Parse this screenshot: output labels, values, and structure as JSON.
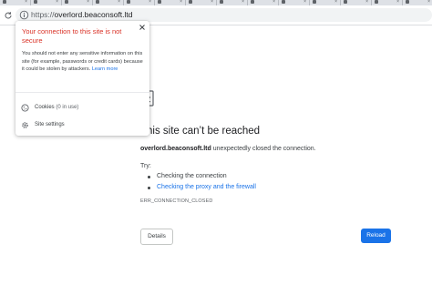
{
  "tabs": [
    {
      "label": "",
      "color": "#5f6368"
    },
    {
      "label": "",
      "color": "#5f6368"
    },
    {
      "label": "",
      "color": "#5f6368"
    },
    {
      "label": "",
      "color": "#5f6368"
    },
    {
      "label": "",
      "color": "#5f6368"
    },
    {
      "label": "",
      "color": "#5f6368"
    },
    {
      "label": "",
      "color": "#5f6368"
    },
    {
      "label": "",
      "color": "#5f6368"
    },
    {
      "label": "",
      "color": "#5f6368"
    },
    {
      "label": "",
      "color": "#5f6368"
    },
    {
      "label": "",
      "color": "#5f6368"
    },
    {
      "label": "",
      "color": "#5f6368"
    },
    {
      "label": "",
      "color": "#5f6368"
    },
    {
      "label": "",
      "color": "#5f6368"
    }
  ],
  "toolbar": {
    "url_scheme": "https://",
    "url_host": "overlord.beaconsoft.ltd",
    "reload_icon": "reload-icon",
    "info_icon": "info-icon"
  },
  "popup": {
    "title": "Your connection to this site is not secure",
    "body": "You should not enter any sensitive information on this site (for example, passwords or credit cards) because it could be stolen by attackers.",
    "learn_more": "Learn more",
    "cookies_label": "Cookies",
    "cookies_sub": "(0 in use)",
    "site_settings_label": "Site settings"
  },
  "error": {
    "heading": "This site can’t be reached",
    "host": "overlord.beaconsoft.ltd",
    "description": "unexpectedly closed the connection.",
    "try_label": "Try:",
    "suggestions": [
      {
        "text": "Checking the connection",
        "is_link": false
      },
      {
        "text": "Checking the proxy and the firewall",
        "is_link": true
      }
    ],
    "code": "ERR_CONNECTION_CLOSED",
    "details_button": "Details",
    "reload_button": "Reload"
  },
  "colors": {
    "accent": "#1a73e8",
    "warning": "#d93025"
  }
}
